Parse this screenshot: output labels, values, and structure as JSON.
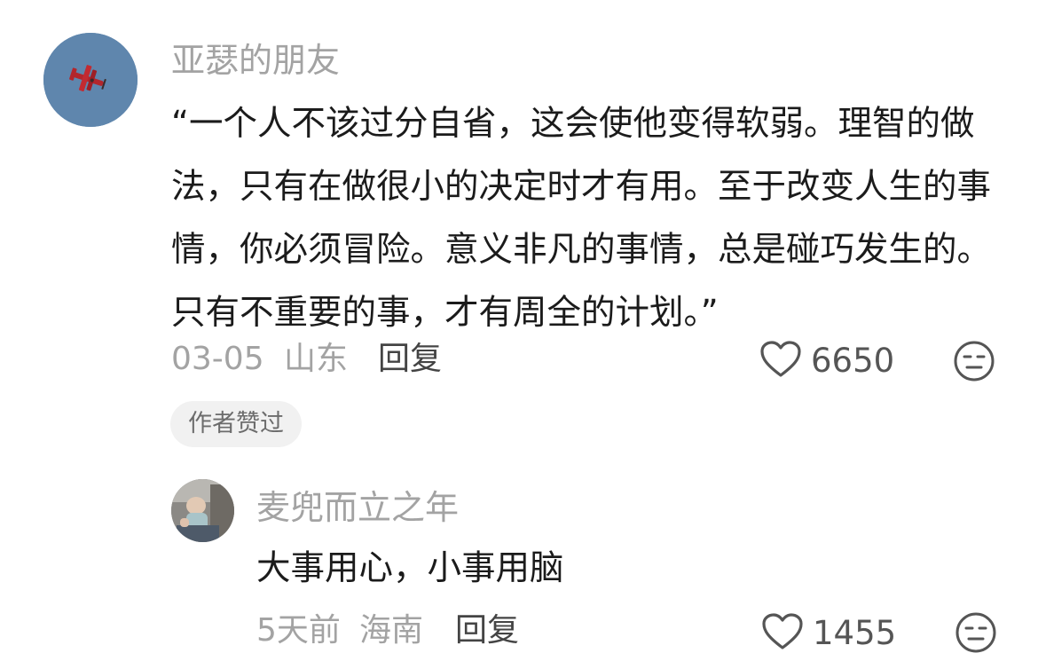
{
  "main_comment": {
    "username": "亚瑟的朋友",
    "text": "“一个人不该过分自省，这会使他变得软弱。理智的做法，只有在做很小的决定时才有用。至于改变人生的事情，你必须冒险。意义非凡的事情，总是碰巧发生的。只有不重要的事，才有周全的计划。”",
    "date": "03-05",
    "location": "山东",
    "reply_label": "回复",
    "like_count": "6650",
    "badge": "作者赞过",
    "avatar_icon": "red-biplane-icon",
    "avatar_bg": "#5f86ad"
  },
  "reply_comment": {
    "username": "麦兜而立之年",
    "text": "大事用心，小事用脑",
    "date": "5天前",
    "location": "海南",
    "reply_label": "回复",
    "like_count": "1455",
    "avatar_icon": "baby-photo-icon"
  },
  "icons": {
    "like": "heart-outline-icon",
    "dislike": "unamused-face-icon"
  }
}
